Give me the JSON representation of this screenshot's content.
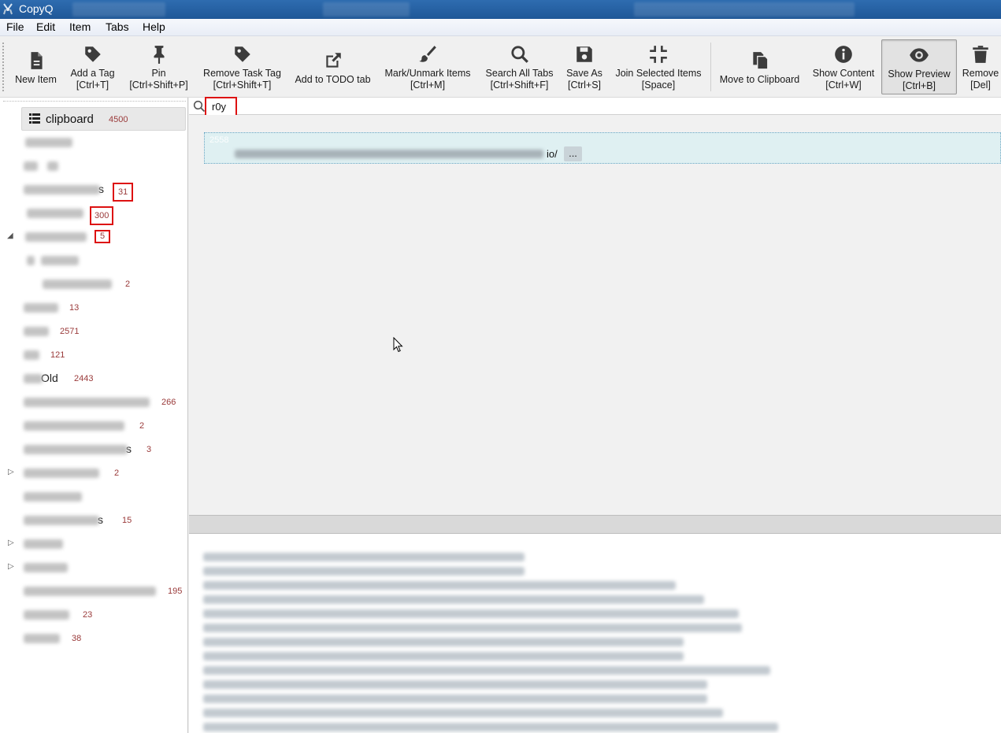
{
  "window": {
    "title": "CopyQ"
  },
  "menu": [
    "File",
    "Edit",
    "Item",
    "Tabs",
    "Help"
  ],
  "toolbar": [
    {
      "icon": "file-icon",
      "line1": "New Item",
      "line2": ""
    },
    {
      "icon": "tag-icon",
      "line1": "Add a Tag",
      "line2": "[Ctrl+T]"
    },
    {
      "icon": "pin-icon",
      "line1": "Pin",
      "line2": "[Ctrl+Shift+P]"
    },
    {
      "icon": "tag-icon",
      "line1": "Remove Task Tag",
      "line2": "[Ctrl+Shift+T]"
    },
    {
      "icon": "external-link-icon",
      "line1": "Add to TODO tab",
      "line2": ""
    },
    {
      "icon": "paintbrush-icon",
      "line1": "Mark/Unmark Items",
      "line2": "[Ctrl+M]"
    },
    {
      "icon": "search-icon",
      "line1": "Search All Tabs",
      "line2": "[Ctrl+Shift+F]"
    },
    {
      "icon": "save-icon",
      "line1": "Save As",
      "line2": "[Ctrl+S]"
    },
    {
      "icon": "compress-icon",
      "line1": "Join Selected Items",
      "line2": "[Space]"
    },
    {
      "icon": "copy-icon",
      "line1": "Move to Clipboard",
      "line2": ""
    },
    {
      "icon": "info-icon",
      "line1": "Show Content",
      "line2": "[Ctrl+W]"
    },
    {
      "icon": "eye-icon",
      "line1": "Show Preview",
      "line2": "[Ctrl+B]",
      "pressed": true
    },
    {
      "icon": "trash-icon",
      "line1": "Remove",
      "line2": "[Del]"
    }
  ],
  "tabs": {
    "selected": {
      "label": "clipboard",
      "count": "4500"
    },
    "counts": [
      "31",
      "300",
      "5",
      "2",
      "13",
      "2571",
      "121",
      "2443",
      "266",
      "2",
      "3",
      "2",
      "15",
      "195",
      "23",
      "38"
    ],
    "visible_tails": [
      "s",
      "Old",
      "s",
      "s"
    ]
  },
  "search": {
    "query": "r0y"
  },
  "item": {
    "number": "2558",
    "tail": "io/",
    "more": "..."
  },
  "colors": {
    "titlebar": "#2e6cb0",
    "selection": "#dff0f2",
    "highlight": "#dd1111",
    "count": "#9a3a3a"
  }
}
